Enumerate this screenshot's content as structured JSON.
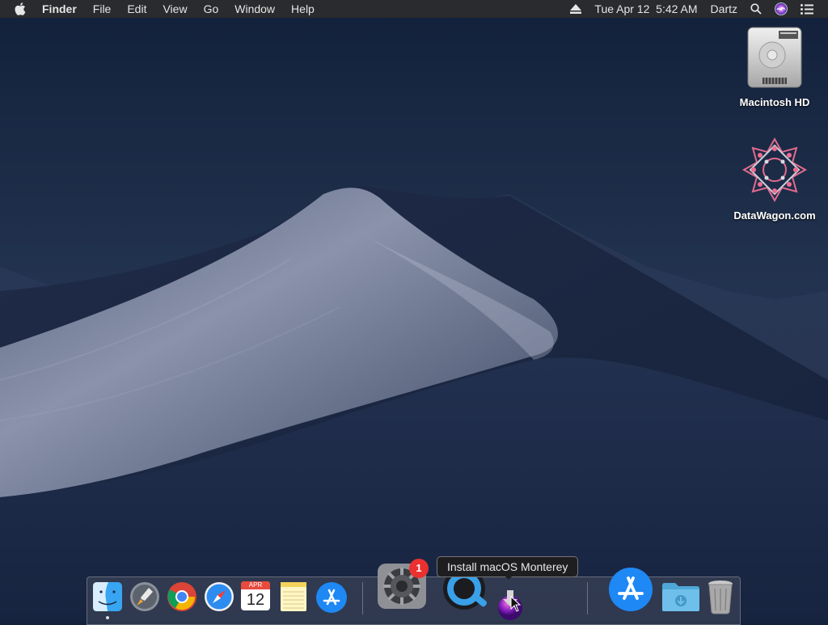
{
  "menubar": {
    "app_name": "Finder",
    "menus": [
      "File",
      "Edit",
      "View",
      "Go",
      "Window",
      "Help"
    ],
    "clock": "Tue Apr 12  5:42 AM",
    "user": "Dartz",
    "status_icons": [
      "eject-icon",
      "search-icon",
      "siri-icon",
      "control-center-icon"
    ]
  },
  "desktop": {
    "icons": [
      {
        "label": "Macintosh HD",
        "icon": "hard-drive-icon"
      },
      {
        "label": "DataWagon.com",
        "icon": "network-share-icon"
      }
    ]
  },
  "dock": {
    "apps": [
      {
        "name": "Finder",
        "icon": "finder-icon",
        "running": true
      },
      {
        "name": "Launchpad",
        "icon": "launchpad-icon"
      },
      {
        "name": "Google Chrome",
        "icon": "chrome-icon"
      },
      {
        "name": "Safari",
        "icon": "safari-icon"
      },
      {
        "name": "Calendar",
        "icon": "calendar-icon",
        "month": "APR",
        "day": "12"
      },
      {
        "name": "Notes",
        "icon": "notes-icon"
      },
      {
        "name": "App Store",
        "icon": "app-store-icon"
      },
      {
        "name": "System Preferences",
        "icon": "system-preferences-icon",
        "badge": "1"
      },
      {
        "name": "QuickTime Player",
        "icon": "quicktime-icon"
      },
      {
        "name": "Install macOS Monterey",
        "icon": "install-macos-icon"
      },
      {
        "name": "App Store",
        "icon": "app-store-icon"
      },
      {
        "name": "Downloads",
        "icon": "downloads-folder-icon"
      },
      {
        "name": "Trash",
        "icon": "trash-icon"
      }
    ],
    "tooltip": "Install macOS Monterey"
  },
  "colors": {
    "menubar": "#2a2b2e",
    "badge": "#ea3030",
    "sky_top": "#13213b",
    "dune": "#7d869e"
  }
}
